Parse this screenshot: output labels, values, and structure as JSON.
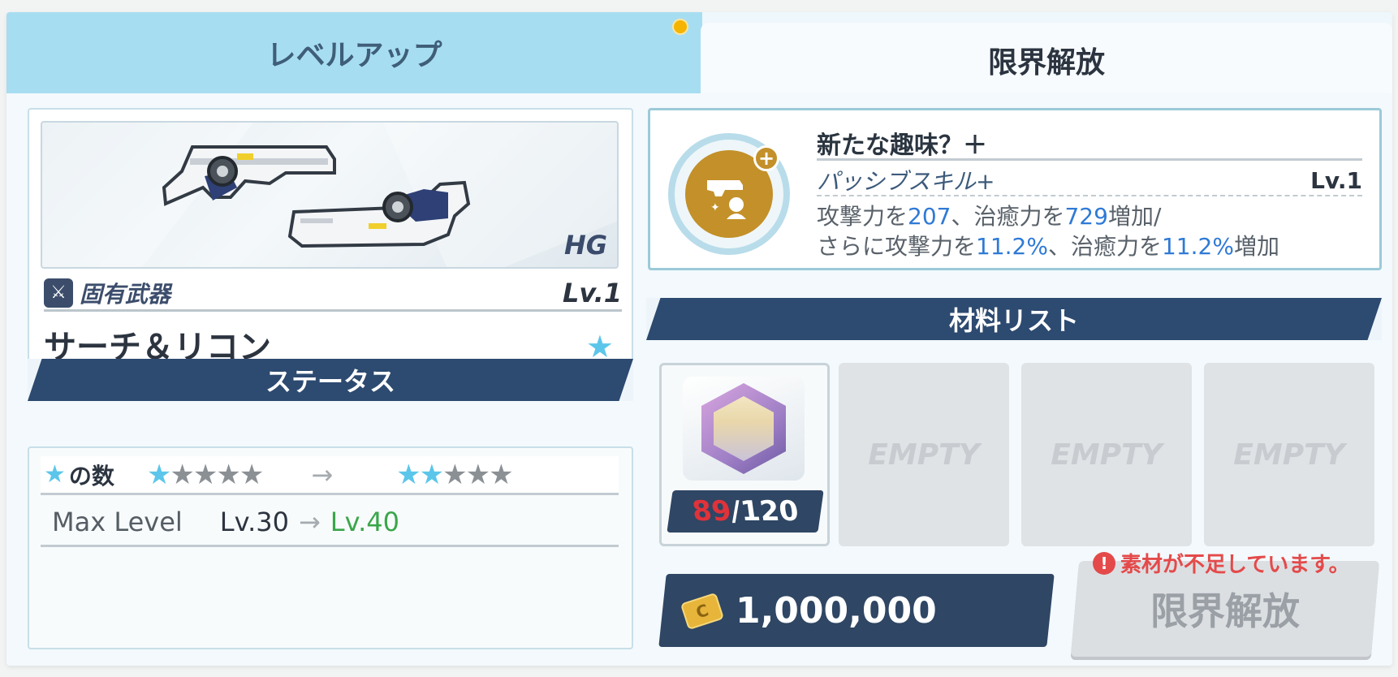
{
  "tabs": {
    "level_up": "レベルアップ",
    "limit_break": "限界解放"
  },
  "weapon": {
    "type": "HG",
    "category": "固有武器",
    "level": "Lv.1",
    "name": "サーチ＆リコン",
    "star_glyph": "★"
  },
  "status": {
    "header": "ステータス",
    "stars_label": "の数",
    "stars_current": 1,
    "stars_next": 2,
    "stars_total": 5,
    "max_level_label": "Max Level",
    "max_level_from": "Lv.30",
    "max_level_to": "Lv.40",
    "arrow": "→"
  },
  "skill": {
    "name": "新たな趣味？＋",
    "type": "パッシブスキル+",
    "level": "Lv.1",
    "desc_line1": [
      "攻撃力を",
      "207",
      "、治癒力を",
      "729",
      "増加/"
    ],
    "desc_line2": [
      "さらに攻撃力を",
      "11.2%",
      "、治癒力を",
      "11.2%",
      "増加"
    ]
  },
  "materials": {
    "header": "材料リスト",
    "owned": "89",
    "required": "/120",
    "empty_label": "EMPTY"
  },
  "cost": {
    "value": "1,000,000"
  },
  "warning": "素材が不足しています。",
  "limit_button": "限界解放",
  "colors": {
    "accent_blue": "#2f7ad6",
    "navy": "#2d4a70",
    "warning_red": "#e44a4a",
    "green": "#3aa64a"
  }
}
